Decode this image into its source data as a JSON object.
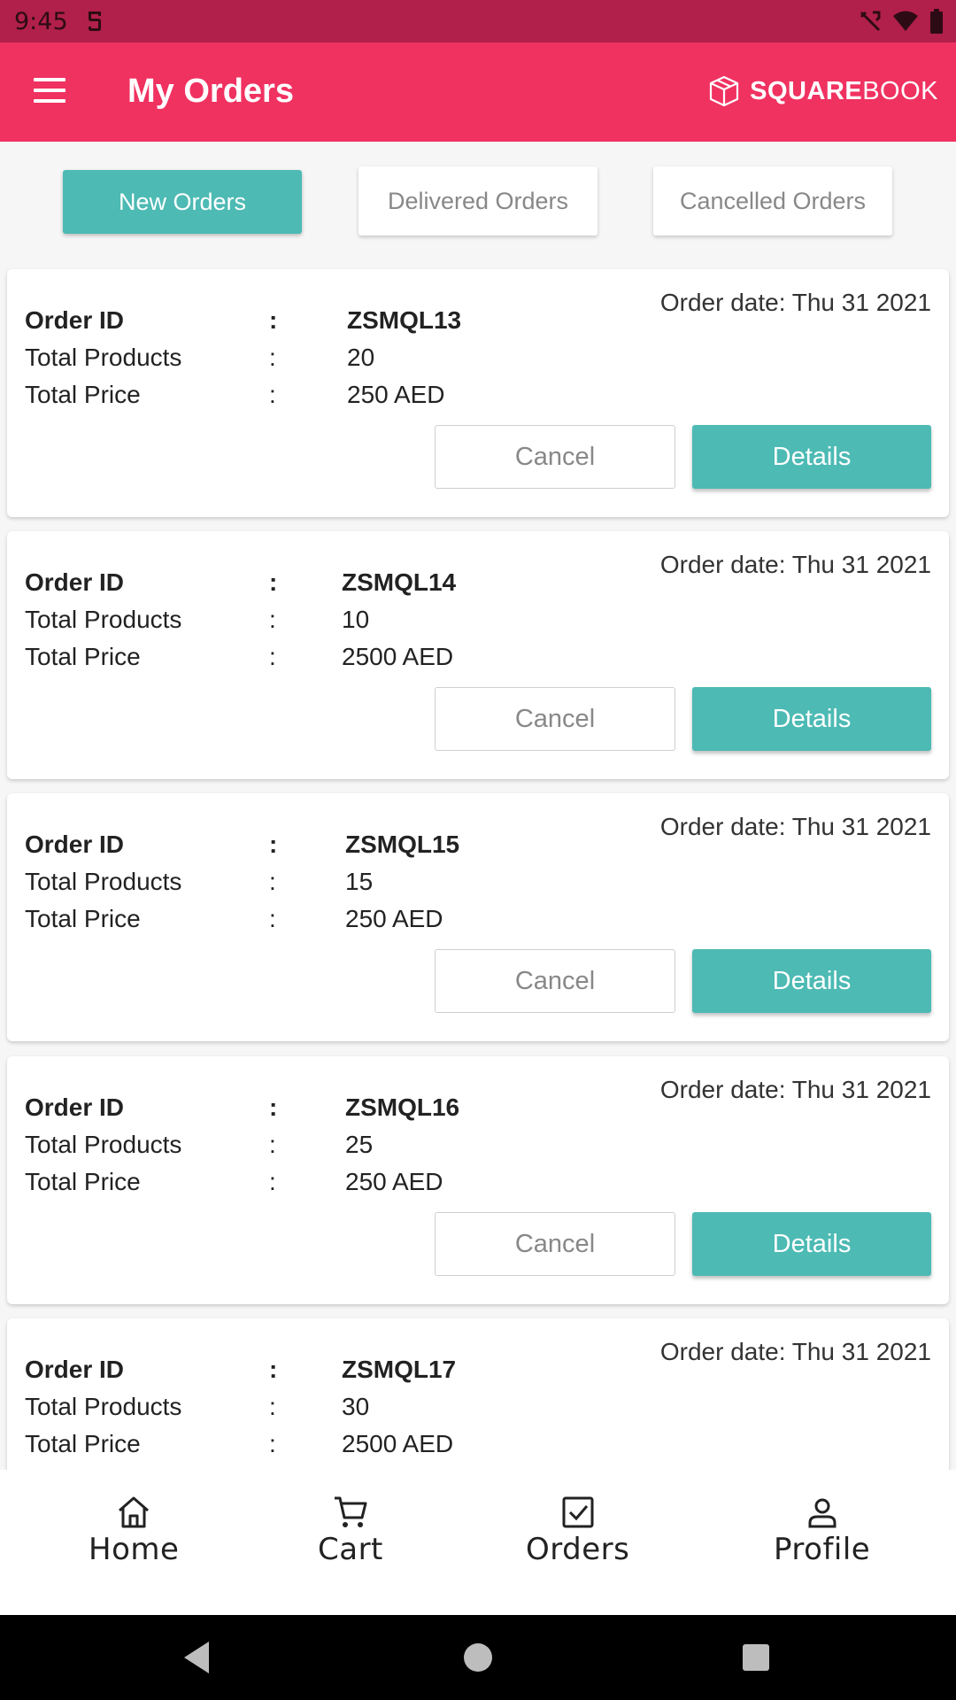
{
  "status_bar": {
    "time": "9:45"
  },
  "app_bar": {
    "title": "My Orders",
    "brand_bold": "SQUARE",
    "brand_light": "BOOK"
  },
  "tabs": [
    {
      "label": "New Orders",
      "active": true
    },
    {
      "label": "Delivered Orders",
      "active": false
    },
    {
      "label": "Cancelled Orders",
      "active": false
    }
  ],
  "labels": {
    "order_id": "Order ID",
    "total_products": "Total Products",
    "total_price": "Total Price",
    "colon": ":",
    "cancel": "Cancel",
    "details": "Details"
  },
  "orders": [
    {
      "date": "Order date: Thu 31 2021",
      "id": "ZSMQL13",
      "products": "20",
      "price": "250 AED"
    },
    {
      "date": "Order date: Thu 31 2021",
      "id": "ZSMQL14",
      "products": "10",
      "price": "2500 AED"
    },
    {
      "date": "Order date: Thu 31 2021",
      "id": "ZSMQL15",
      "products": "15",
      "price": "250 AED"
    },
    {
      "date": "Order date: Thu 31 2021",
      "id": "ZSMQL16",
      "products": "25",
      "price": "250 AED"
    },
    {
      "date": "Order date: Thu 31 2021",
      "id": "ZSMQL17",
      "products": "30",
      "price": "2500 AED"
    }
  ],
  "bottom_nav": [
    {
      "label": "Home",
      "icon": "home-icon"
    },
    {
      "label": "Cart",
      "icon": "cart-icon"
    },
    {
      "label": "Orders",
      "icon": "orders-icon"
    },
    {
      "label": "Profile",
      "icon": "profile-icon"
    }
  ],
  "colors": {
    "primary": "#f03261",
    "accent": "#4dbab4",
    "status_bar": "#b0204a"
  }
}
